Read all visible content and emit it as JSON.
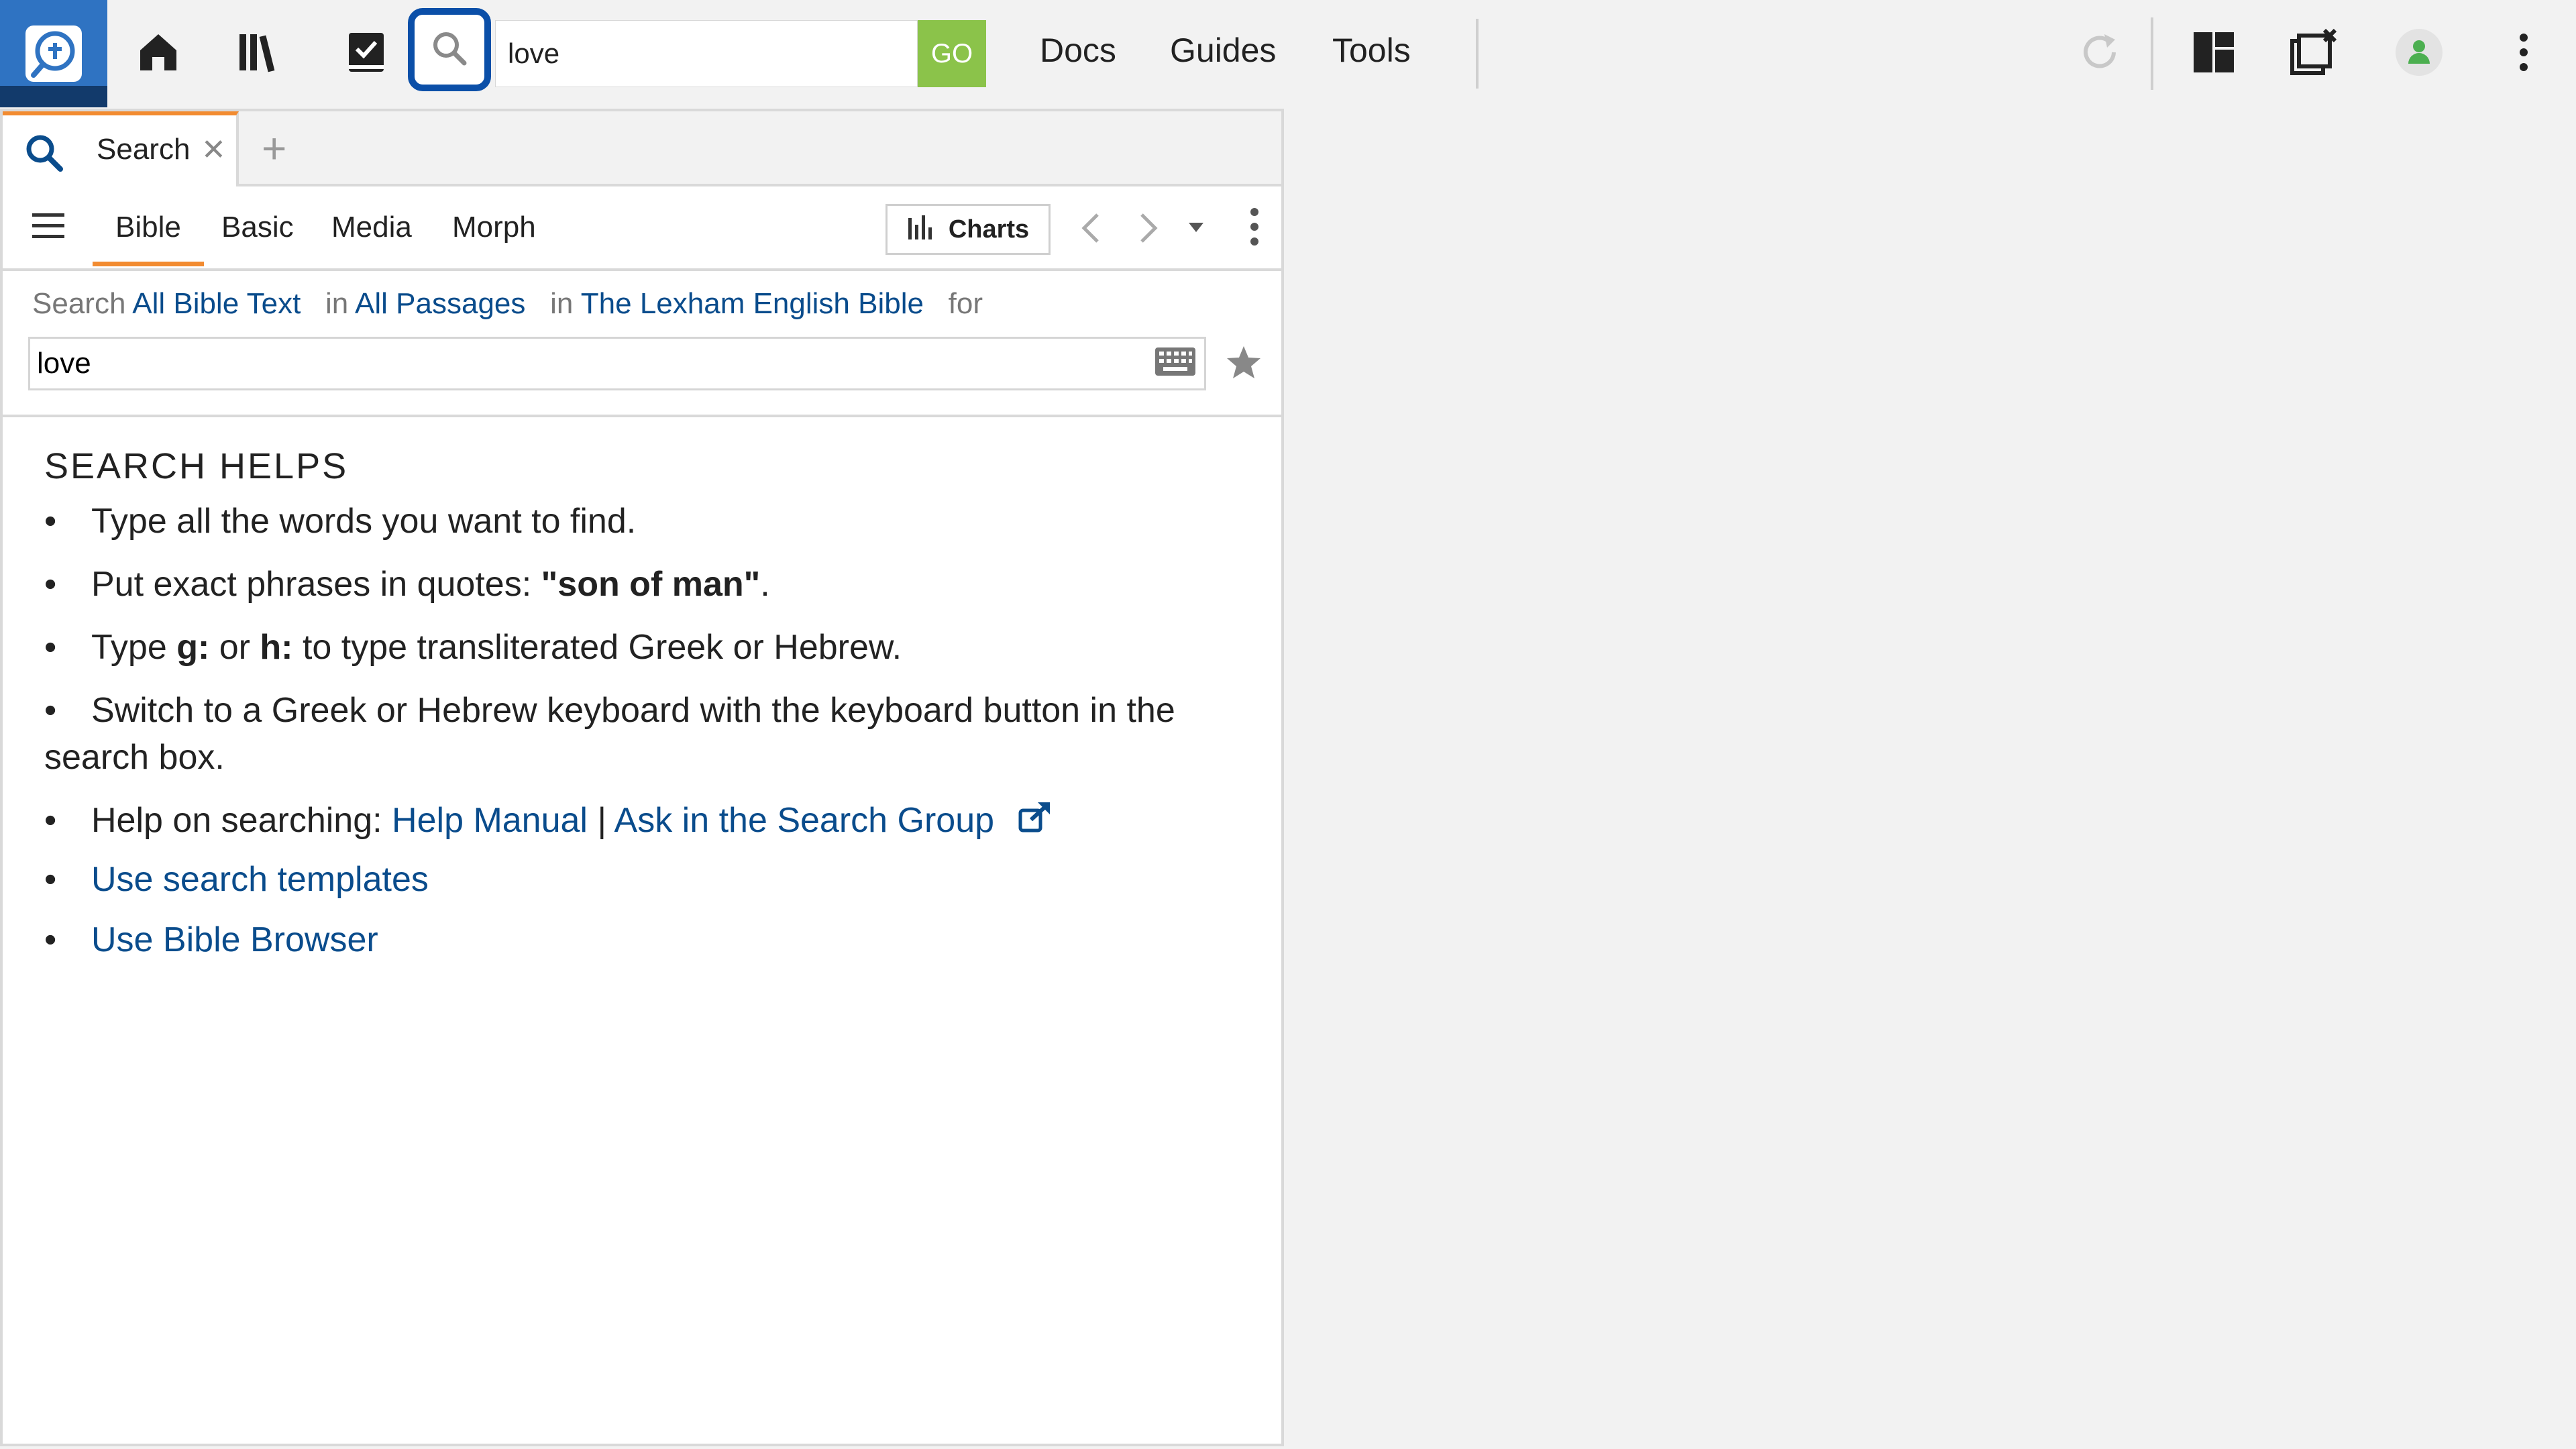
{
  "toolbar": {
    "icons": [
      "app-logo-icon",
      "home-icon",
      "library-icon",
      "tasks-icon",
      "search-icon",
      "sync-icon",
      "layout-icon",
      "close-panels-icon",
      "user-icon",
      "more-vertical-icon"
    ],
    "search_value": "love",
    "go_label": "GO",
    "menu": {
      "docs": "Docs",
      "guides": "Guides",
      "tools": "Tools"
    }
  },
  "panel": {
    "tab": {
      "label": "Search",
      "close": "✕",
      "add": "+"
    },
    "subtabs": {
      "bible": "Bible",
      "basic": "Basic",
      "media": "Media",
      "morph": "Morph"
    },
    "charts_label": "Charts",
    "scope": {
      "prefix": "Search",
      "target": "All Bible Text",
      "in1": "in",
      "passages": "All Passages",
      "in2": "in",
      "resource": "The Lexham English Bible",
      "suffix": "for"
    },
    "query": "love"
  },
  "helps": {
    "title": "SEARCH HELPS",
    "bullet": "•",
    "item1": "Type all the words you want to find.",
    "item2_prefix": "Put exact phrases in quotes: ",
    "item2_bold": "\"son of man\"",
    "item2_suffix": ".",
    "item3_a": "Type ",
    "item3_g": "g:",
    "item3_b": " or ",
    "item3_h": "h:",
    "item3_c": " to type transliterated Greek or Hebrew.",
    "item4": "Switch to a Greek or Hebrew keyboard with the keyboard button in the search box.",
    "item5_prefix": "Help on searching: ",
    "item5_link1": "Help Manual",
    "item5_sep": " | ",
    "item5_link2": "Ask in the Search Group",
    "item6": "Use search templates",
    "item7": "Use Bible Browser"
  },
  "colors": {
    "accent": "#f28b30",
    "link": "#0a4c8c",
    "go": "#8bc34a",
    "logo": "#2f73c2",
    "focus": "#0b4fa8",
    "user": "#4caf50"
  }
}
